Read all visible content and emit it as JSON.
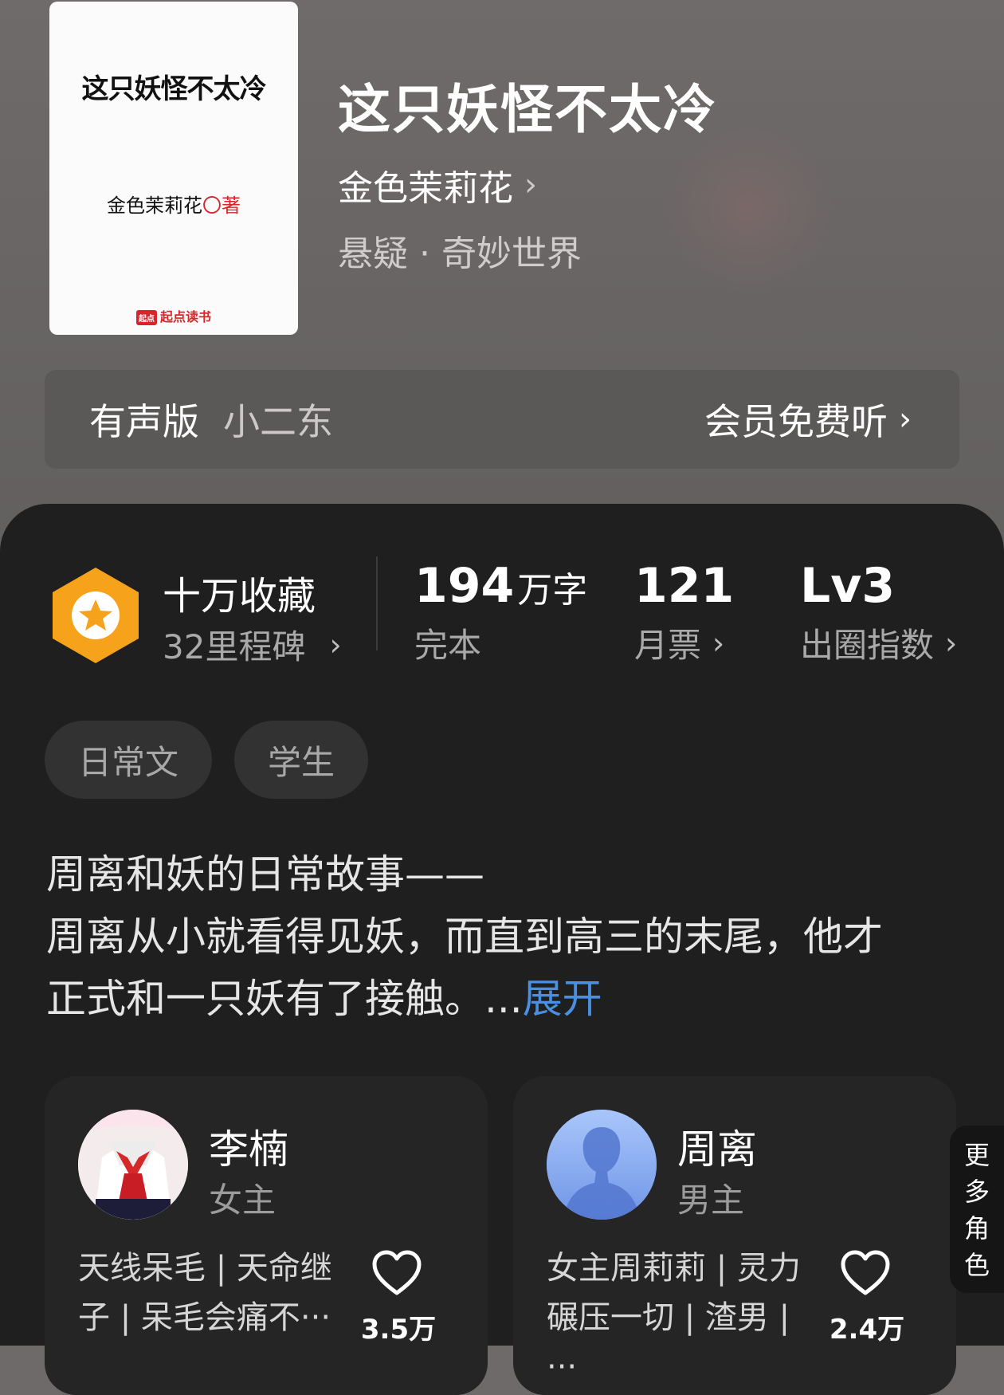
{
  "cover": {
    "title": "这只妖怪不太冷",
    "author_line": "金色茉莉花",
    "author_mark": "〇著",
    "brand_logo": "起点",
    "brand": "起点读书"
  },
  "book": {
    "title": "这只妖怪不太冷",
    "author": "金色茉莉花",
    "genre": "悬疑 · 奇妙世界"
  },
  "audio": {
    "label": "有声版",
    "narrator": "小二东",
    "cta": "会员免费听"
  },
  "stats": {
    "collect_title": "十万收藏",
    "collect_sub": "32里程碑",
    "words_value": "194",
    "words_unit": "万字",
    "words_label": "完本",
    "tickets_value": "121",
    "tickets_label": "月票",
    "level_value": "Lv3",
    "level_label": "出圈指数"
  },
  "tags": [
    "日常文",
    "学生"
  ],
  "description": {
    "line1": "周离和妖的日常故事——",
    "line2": "周离从小就看得见妖，而直到高三的末尾，他才",
    "line3": "正式和一只妖有了接触。...",
    "expand": "展开"
  },
  "characters": [
    {
      "name": "李楠",
      "role": "女主",
      "tags": "天线呆毛 | 天命继子 | 呆毛会痛不···",
      "likes": "3.5万"
    },
    {
      "name": "周离",
      "role": "男主",
      "tags": "女主周莉莉 | 灵力碾压一切 | 渣男 |···",
      "likes": "2.4万"
    }
  ],
  "more_roles": [
    "更",
    "多",
    "角",
    "色"
  ],
  "colors": {
    "accent_blue": "#4a90e2",
    "badge_orange": "#f7a21b",
    "panel": "#1f1f1f",
    "header_bg": "#6e6a6a"
  },
  "icons": [
    "star-badge-icon",
    "chevron-right-icon",
    "heart-icon"
  ]
}
